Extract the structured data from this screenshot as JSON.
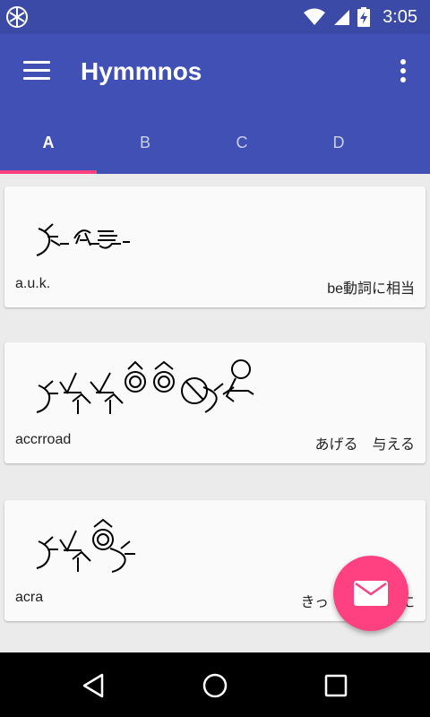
{
  "status_bar": {
    "time": "3:05",
    "icons": [
      "app-notification-icon",
      "wifi-icon",
      "cell-signal-icon",
      "battery-charging-icon"
    ]
  },
  "app_bar": {
    "title": "Hymmnos",
    "icons": [
      "menu-icon",
      "more-vert-icon"
    ]
  },
  "tabs": [
    {
      "label": "A",
      "active": true
    },
    {
      "label": "B",
      "active": false
    },
    {
      "label": "C",
      "active": false
    },
    {
      "label": "D",
      "active": false
    }
  ],
  "words": [
    {
      "word": "a.u.k.",
      "meaning": "be動詞に相当"
    },
    {
      "word": "accrroad",
      "meaning": "あげる　与える"
    },
    {
      "word": "acra",
      "meaning": "きっ　　　　　に"
    }
  ],
  "fab": {
    "icon": "mail-icon"
  },
  "nav_bar": {
    "icons": [
      "back-icon",
      "home-icon",
      "recents-icon"
    ]
  },
  "colors": {
    "primary": "#4050b5",
    "primary_dark": "#3a4aa6",
    "accent": "#ff4081",
    "background": "#ebebeb",
    "card": "#fafafa"
  }
}
